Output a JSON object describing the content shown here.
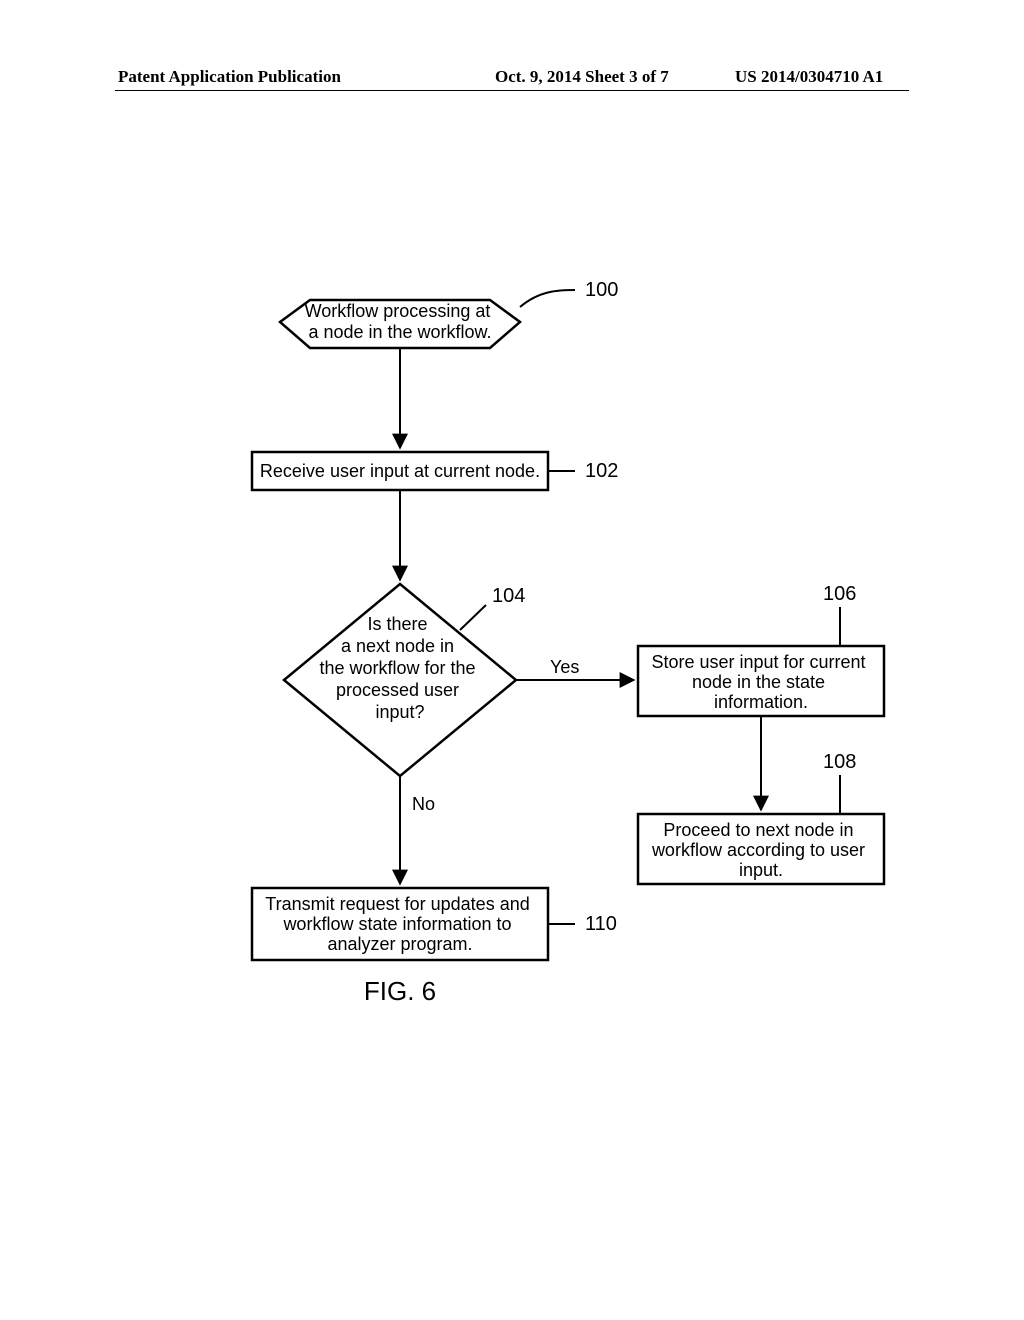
{
  "header": {
    "left": "Patent Application Publication",
    "middle": "Oct. 9, 2014  Sheet 3 of 7",
    "right": "US 2014/0304710 A1"
  },
  "figure_label": "FIG. 6",
  "nodes": {
    "n100": {
      "ref": "100",
      "text": "Workflow processing at\na node in the workflow."
    },
    "n102": {
      "ref": "102",
      "text": "Receive user input at current node."
    },
    "n104": {
      "ref": "104",
      "text": "Is there\na next node in\nthe workflow for the\nprocessed user\ninput?"
    },
    "n106": {
      "ref": "106",
      "text": "Store user input for current\nnode in the state\ninformation."
    },
    "n108": {
      "ref": "108",
      "text": "Proceed to next node in\nworkflow according to user\ninput."
    },
    "n110": {
      "ref": "110",
      "text": "Transmit request for updates and\nworkflow state information to\nanalyzer program."
    }
  },
  "edges": {
    "yes": "Yes",
    "no": "No"
  }
}
